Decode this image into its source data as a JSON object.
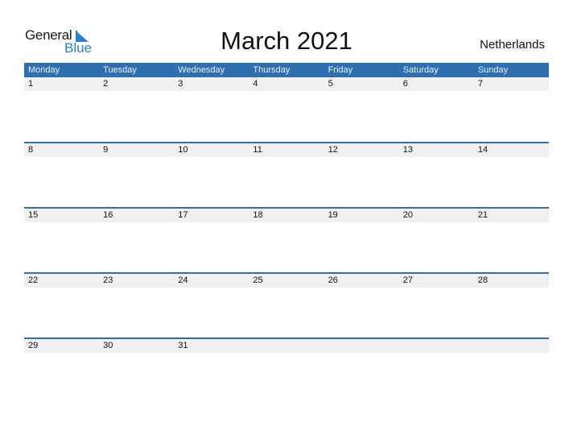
{
  "logo": {
    "general": "General",
    "blue": "Blue"
  },
  "title": "March 2021",
  "country": "Netherlands",
  "weekdays": [
    "Monday",
    "Tuesday",
    "Wednesday",
    "Thursday",
    "Friday",
    "Saturday",
    "Sunday"
  ],
  "weeks": [
    [
      "1",
      "2",
      "3",
      "4",
      "5",
      "6",
      "7"
    ],
    [
      "8",
      "9",
      "10",
      "11",
      "12",
      "13",
      "14"
    ],
    [
      "15",
      "16",
      "17",
      "18",
      "19",
      "20",
      "21"
    ],
    [
      "22",
      "23",
      "24",
      "25",
      "26",
      "27",
      "28"
    ],
    [
      "29",
      "30",
      "31",
      "",
      "",
      "",
      ""
    ]
  ],
  "colors": {
    "accent": "#2e6fb1",
    "logo_blue": "#2a7fd0",
    "date_bar": "#f0f0f0"
  }
}
